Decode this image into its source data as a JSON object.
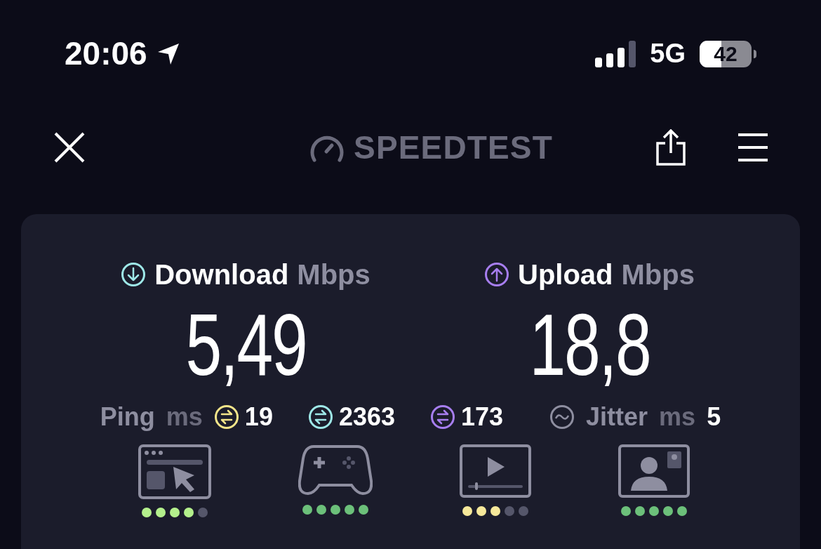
{
  "status_bar": {
    "time": "20:06",
    "network": "5G",
    "battery": "42"
  },
  "header": {
    "logo": "SPEEDTEST"
  },
  "download": {
    "label": "Download",
    "unit": "Mbps",
    "value": "5,49",
    "color": "#9ee8e8"
  },
  "upload": {
    "label": "Upload",
    "unit": "Mbps",
    "value": "18,8",
    "color": "#a77ef0"
  },
  "ping": {
    "label": "Ping",
    "unit": "ms",
    "values": [
      {
        "value": "19",
        "color": "#f4e58a"
      },
      {
        "value": "2363",
        "color": "#9ee8e8"
      },
      {
        "value": "173",
        "color": "#a77ef0"
      }
    ]
  },
  "jitter": {
    "label": "Jitter",
    "unit": "ms",
    "value": "5"
  },
  "ratings": [
    {
      "kind": "browsing",
      "stars": 4,
      "color": "#b4f08c"
    },
    {
      "kind": "gaming",
      "stars": 5,
      "color": "#6cc07a"
    },
    {
      "kind": "streaming",
      "stars": 3,
      "color": "#f6e89a"
    },
    {
      "kind": "video_call",
      "stars": 5,
      "color": "#6cc07a"
    }
  ]
}
